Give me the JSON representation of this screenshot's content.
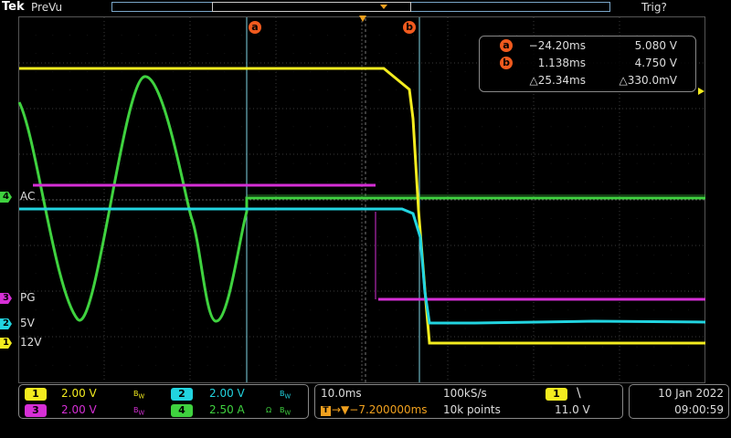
{
  "header": {
    "brand": "Tek",
    "mode": "PreVu",
    "trigger_status": "Trig?"
  },
  "colors": {
    "ch1": "#f3ec1f",
    "ch2": "#22d4e0",
    "ch3": "#d62fd6",
    "ch4": "#3fd23f",
    "cursor": "#f05a1e",
    "trigger": "#f0a01e"
  },
  "channels": {
    "ch1": {
      "number": "1",
      "label": "12V",
      "scale": "2.00 V",
      "bw_icon": "bandwidth-limit-icon"
    },
    "ch2": {
      "number": "2",
      "label": "5V",
      "scale": "2.00 V",
      "bw_icon": "bandwidth-limit-icon"
    },
    "ch3": {
      "number": "3",
      "label": "PG",
      "scale": "2.00 V",
      "bw_icon": "bandwidth-limit-icon"
    },
    "ch4": {
      "number": "4",
      "label": "AC",
      "scale": "2.50 A",
      "bw_icon": "bandwidth-limit-icon",
      "unit_icon": "ohm-icon"
    }
  },
  "cursors": {
    "a": {
      "tag": "a",
      "time": "−24.20ms",
      "value": "5.080 V"
    },
    "b": {
      "tag": "b",
      "time": "1.138ms",
      "value": "4.750 V"
    },
    "delta": {
      "time": "△25.34ms",
      "value": "△330.0mV"
    }
  },
  "timebase": {
    "scale": "10.0ms",
    "sample_rate": "100kS/s",
    "delay": "→▼−7.200000ms",
    "record_length": "10k points"
  },
  "trigger": {
    "source": "1",
    "slope_icon": "falling-edge-icon",
    "level": "11.0 V"
  },
  "datetime": {
    "date": "10 Jan  2022",
    "time": "09:00:59"
  }
}
